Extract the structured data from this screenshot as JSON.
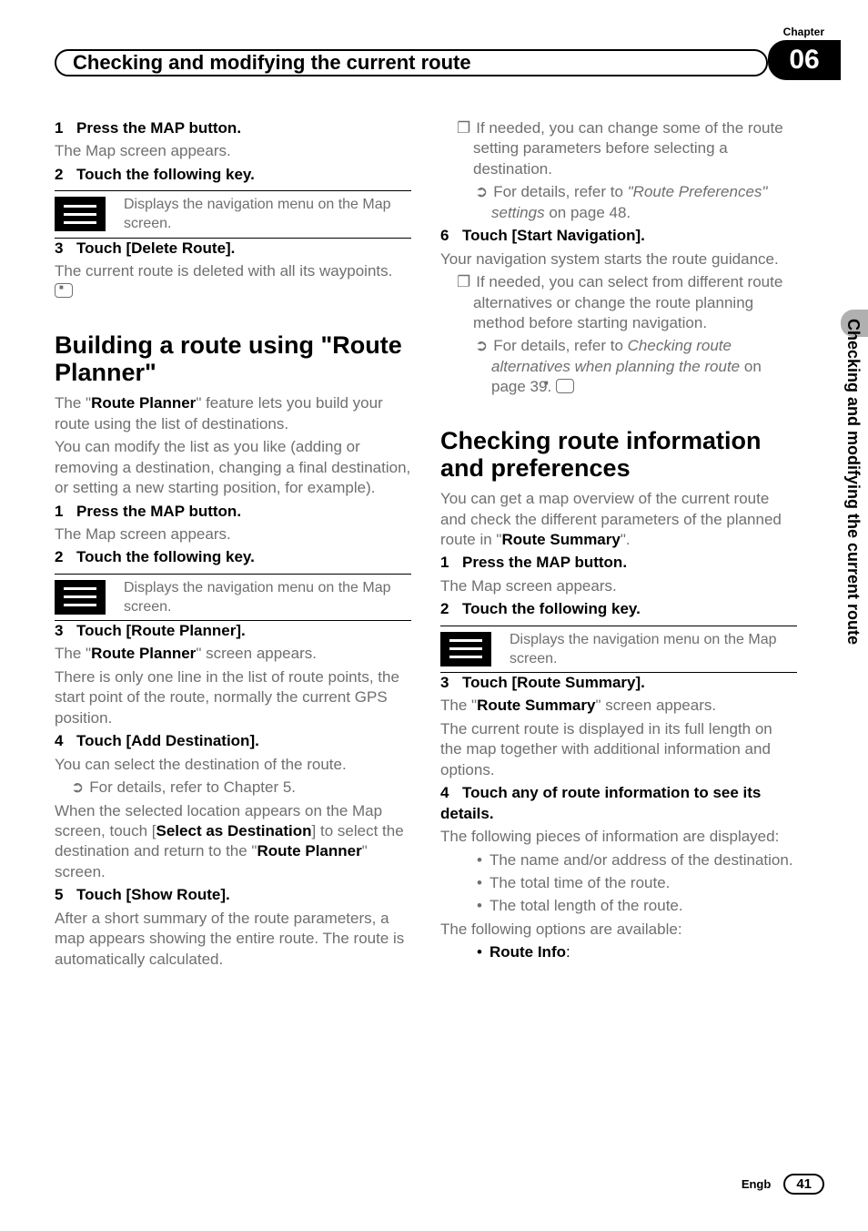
{
  "chapter": {
    "label": "Chapter",
    "number": "06",
    "title": "Checking and modifying the current route",
    "side_text": "Checking and modifying the current route"
  },
  "left": {
    "s1": {
      "num": "1",
      "title": "Press the MAP button.",
      "body": "The Map screen appears."
    },
    "s2": {
      "num": "2",
      "title": "Touch the following key.",
      "key_desc": "Displays the navigation menu on the Map screen."
    },
    "s3": {
      "num": "3",
      "title": "Touch [Delete Route].",
      "body_a": "The current route is deleted with all its waypoints."
    },
    "h2a": "Building a route using \"Route Planner\"",
    "intro_a": "The \"",
    "intro_b": "Route Planner",
    "intro_c": "\" feature lets you build your route using the list of destinations.",
    "intro_d": "You can modify the list as you like (adding or removing a destination, changing a final destination, or setting a new starting position, for example).",
    "s1b": {
      "num": "1",
      "title": "Press the MAP button.",
      "body": "The Map screen appears."
    },
    "s2b": {
      "num": "2",
      "title": "Touch the following key.",
      "key_desc": "Displays the navigation menu on the Map screen."
    },
    "s3b": {
      "num": "3",
      "title": "Touch [Route Planner].",
      "line_a": "The \"",
      "line_b": "Route Planner",
      "line_c": "\" screen appears.",
      "line_d": "There is only one line in the list of route points, the start point of the route, normally the current GPS position."
    },
    "s4": {
      "num": "4",
      "title": "Touch [Add Destination].",
      "body": "You can select the destination of the route.",
      "sub": "For details, refer to Chapter 5.",
      "body2_a": "When the selected location appears on the Map screen, touch [",
      "body2_b": "Select as Destination",
      "body2_c": "] to select the destination and return to the \"",
      "body2_d": "Route Planner",
      "body2_e": "\" screen."
    },
    "s5": {
      "num": "5",
      "title": "Touch [Show Route].",
      "body": "After a short summary of the route parameters, a map appears showing the entire route. The route is automatically calculated."
    }
  },
  "right": {
    "r1": {
      "body": "If needed, you can change some of the route setting parameters before selecting a destination.",
      "sub_a": "For details, refer to ",
      "sub_b": "\"Route Preferences\" settings",
      "sub_c": " on page 48."
    },
    "s6": {
      "num": "6",
      "title": "Touch [Start Navigation].",
      "body": "Your navigation system starts the route guidance.",
      "sub1": "If needed, you can select from different route alternatives or change the route planning method before starting navigation.",
      "sub2_a": "For details, refer to ",
      "sub2_b": "Checking route alternatives when planning the route",
      "sub2_c": " on page 39."
    },
    "h2b": "Checking route information and preferences",
    "intro_a": "You can get a map overview of the current route and check the different parameters of the planned route in \"",
    "intro_b": "Route Summary",
    "intro_c": "\".",
    "s1": {
      "num": "1",
      "title": "Press the MAP button.",
      "body": "The Map screen appears."
    },
    "s2": {
      "num": "2",
      "title": "Touch the following key.",
      "key_desc": "Displays the navigation menu on the Map screen."
    },
    "s3": {
      "num": "3",
      "title": "Touch [Route Summary].",
      "line_a": "The \"",
      "line_b": "Route Summary",
      "line_c": "\" screen appears.",
      "body": "The current route is displayed in its full length on the map together with additional information and options."
    },
    "s4": {
      "num": "4",
      "title": "Touch any of route information to see its details.",
      "body": "The following pieces of information are displayed:",
      "b1": "The name and/or address of the destination.",
      "b2": "The total time of the route.",
      "b3": "The total length of the route.",
      "opts": "The following options are available:",
      "o1": "Route Info",
      "o1_suffix": ":"
    }
  },
  "footer": {
    "lang": "Engb",
    "page": "41"
  }
}
